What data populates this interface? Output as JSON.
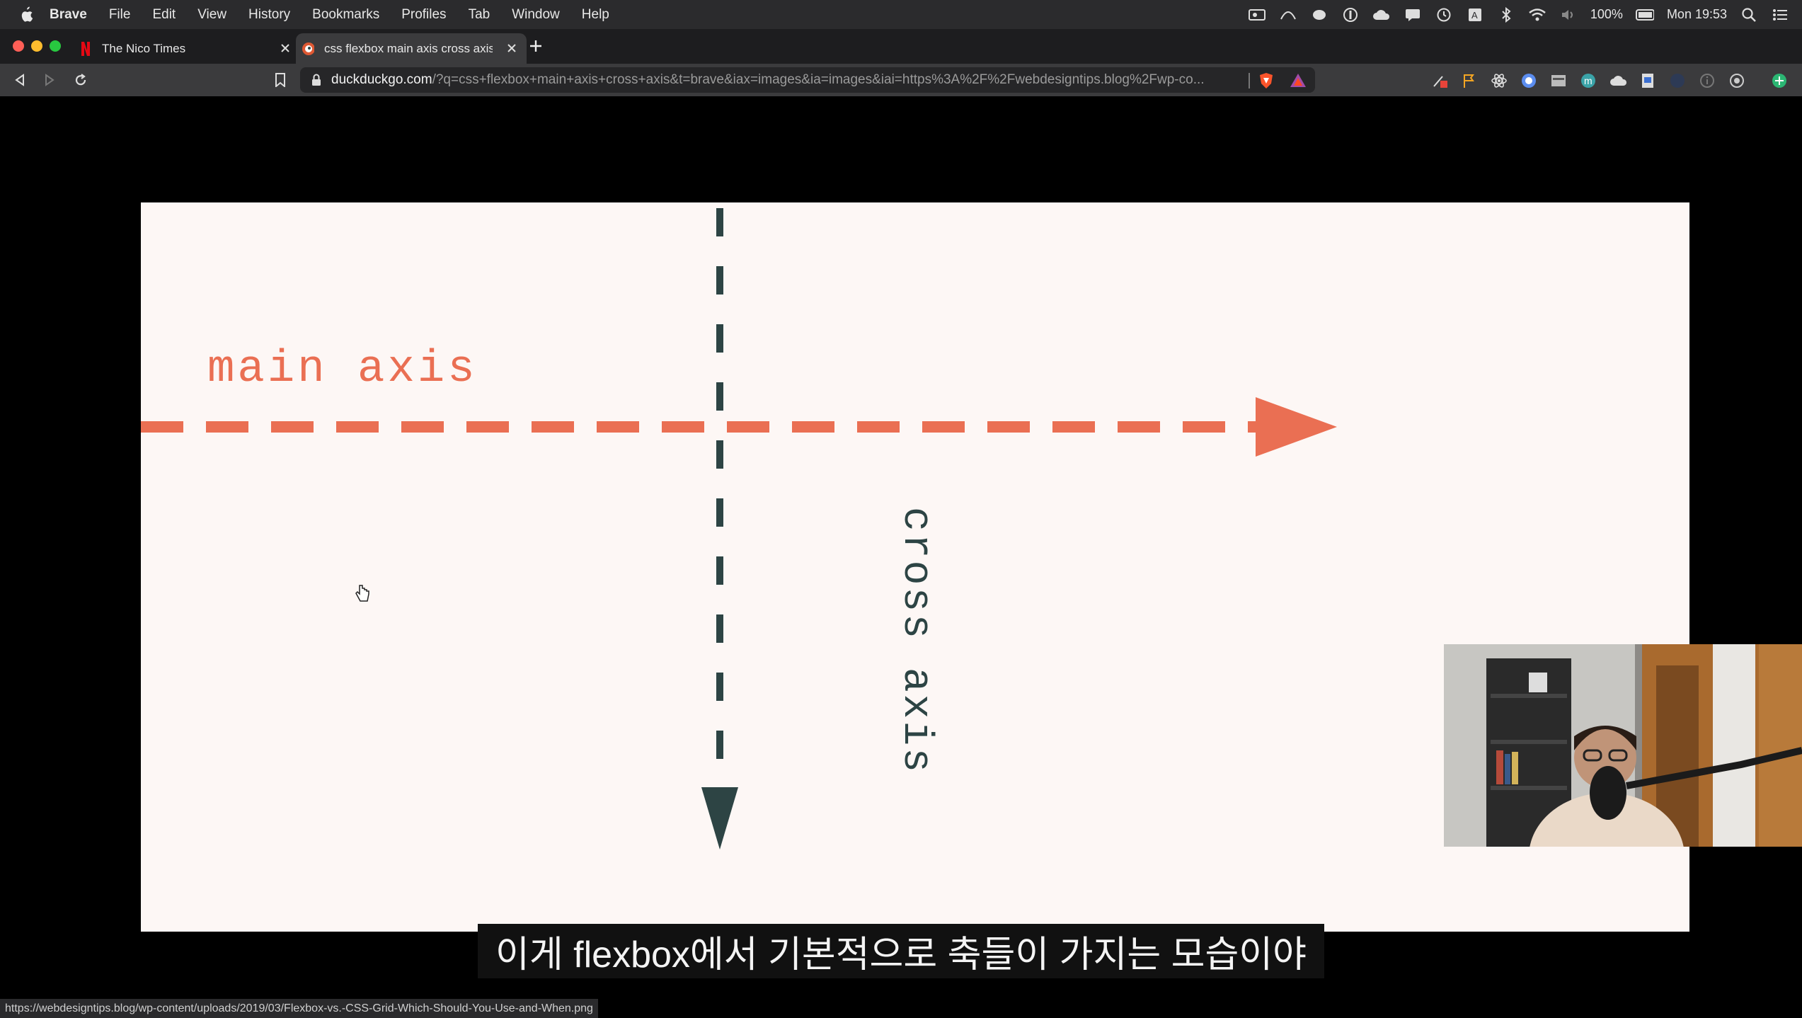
{
  "menubar": {
    "app": "Brave",
    "items": [
      "File",
      "Edit",
      "View",
      "History",
      "Bookmarks",
      "Profiles",
      "Tab",
      "Window",
      "Help"
    ],
    "battery": "100%",
    "clock": "Mon 19:53"
  },
  "tabs": [
    {
      "title": "The Nico Times",
      "active": false
    },
    {
      "title": "css flexbox main axis cross axis",
      "active": true
    }
  ],
  "address": {
    "host": "duckduckgo.com",
    "path": "/?q=css+flexbox+main+axis+cross+axis&t=brave&iax=images&ia=images&iai=https%3A%2F%2Fwebdesigntips.blog%2Fwp-co..."
  },
  "diagram": {
    "main_label": "main axis",
    "cross_label": "cross axis",
    "main_color": "#ea6f53",
    "cross_color": "#2d4444"
  },
  "subtitle": "이게 flexbox에서 기본적으로 축들이 가지는 모습이야",
  "status_url": "https://webdesigntips.blog/wp-content/uploads/2019/03/Flexbox-vs.-CSS-Grid-Which-Should-You-Use-and-When.png",
  "colors": {
    "menubar": "#2b2b2d",
    "tabbar": "#1d1d1f",
    "toolbar": "#3b3b3d"
  }
}
